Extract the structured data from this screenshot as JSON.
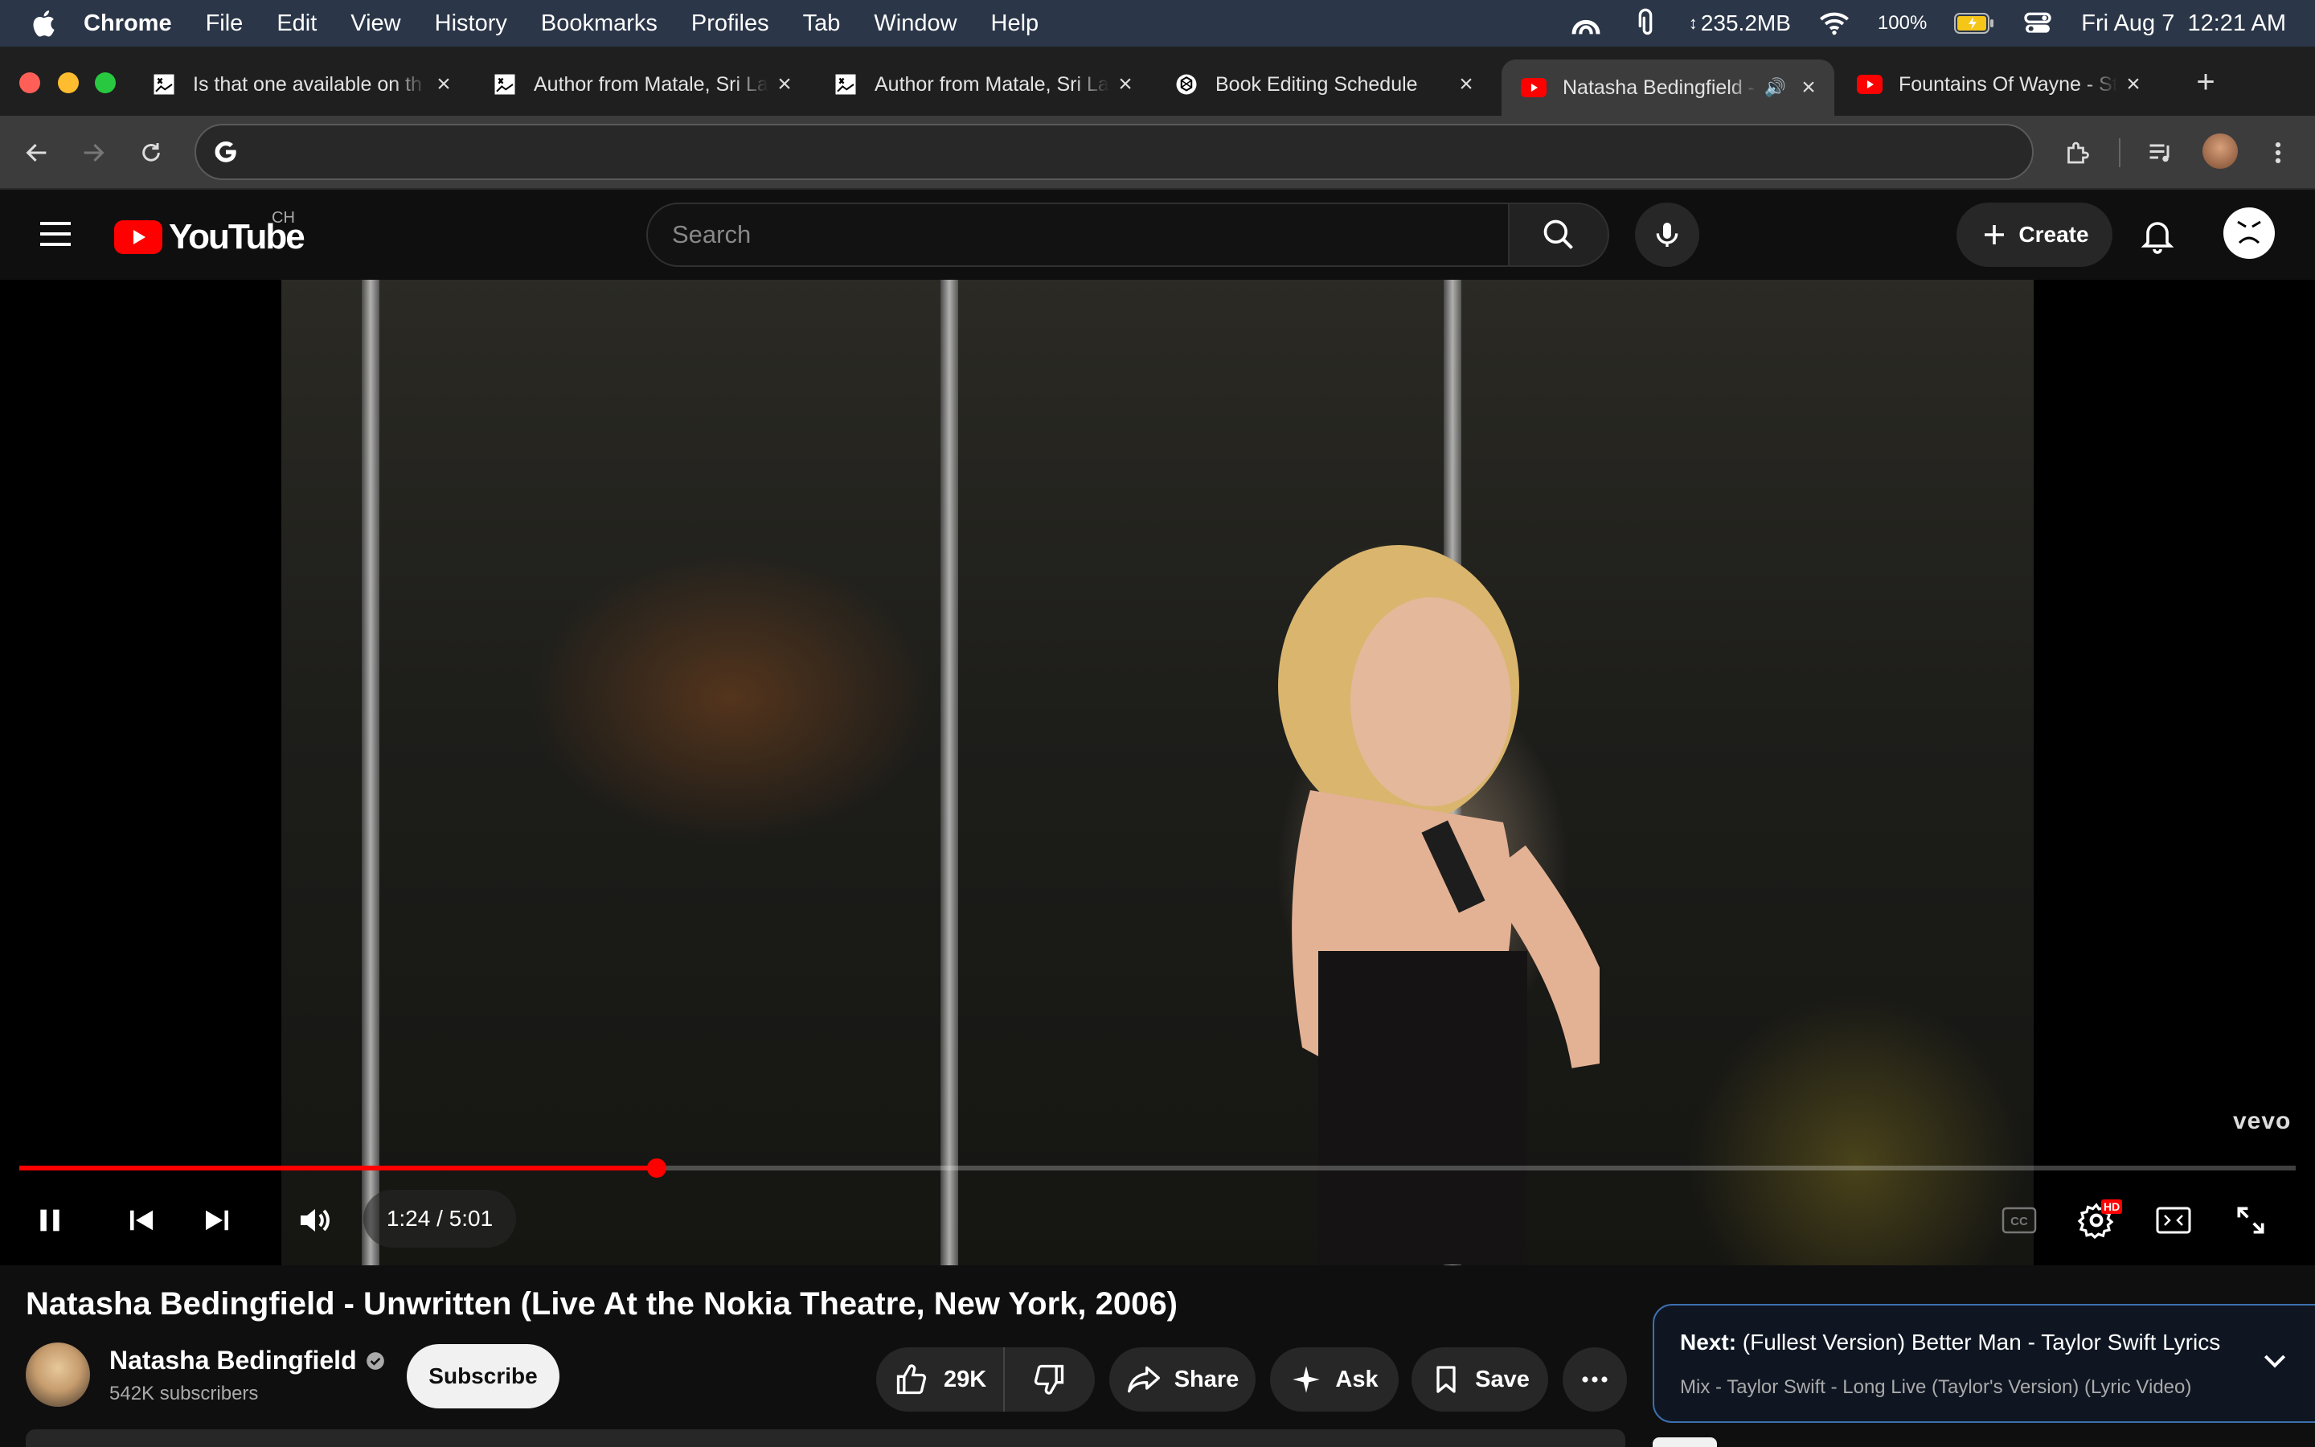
{
  "menubar": {
    "app": "Chrome",
    "items": [
      "File",
      "Edit",
      "View",
      "History",
      "Bookmarks",
      "Profiles",
      "Tab",
      "Window",
      "Help"
    ],
    "memory": "235.2MB",
    "battery": "100%",
    "clock": "Fri Aug 7  12:21 AM"
  },
  "tabs": [
    {
      "title": "Is that one available on th",
      "icon": "doc-icon"
    },
    {
      "title": "Author from Matale, Sri Lanka",
      "icon": "doc-icon"
    },
    {
      "title": "Author from Matale, Sri Lanka",
      "icon": "doc-icon"
    },
    {
      "title": "Book Editing Schedule",
      "icon": "chatgpt-icon"
    },
    {
      "title": "Natasha Bedingfield - Unwritten",
      "icon": "youtube-icon",
      "active": true
    },
    {
      "title": "Fountains Of Wayne - Stacy's Mom",
      "icon": "youtube-icon"
    }
  ],
  "omnibox": {
    "value": ""
  },
  "youtube": {
    "logo_text": "YouTube",
    "country": "CH",
    "search_placeholder": "Search",
    "create_label": "Create"
  },
  "player": {
    "watermark": "vevo",
    "current_time": "1:24",
    "duration": "5:01",
    "progress_fraction": 0.28,
    "buffered_fraction": 0.27,
    "hd_badge": "HD"
  },
  "video": {
    "title": "Natasha Bedingfield - Unwritten (Live At the Nokia Theatre, New York, 2006)",
    "channel": "Natasha Bedingfield",
    "subscribers": "542K subscribers",
    "subscribe_label": "Subscribe",
    "likes": "29K",
    "share_label": "Share",
    "ask_label": "Ask",
    "save_label": "Save"
  },
  "next": {
    "prefix": "Next:",
    "title": "(Fullest Version) Better Man - Taylor Swift Lyrics",
    "subtitle": "Mix - Taylor Swift - Long Live (Taylor's Version) (Lyric Video)"
  },
  "colors": {
    "accent_red": "#ff0000",
    "menubar": "#2b3648",
    "next_border": "#3d6fae"
  }
}
